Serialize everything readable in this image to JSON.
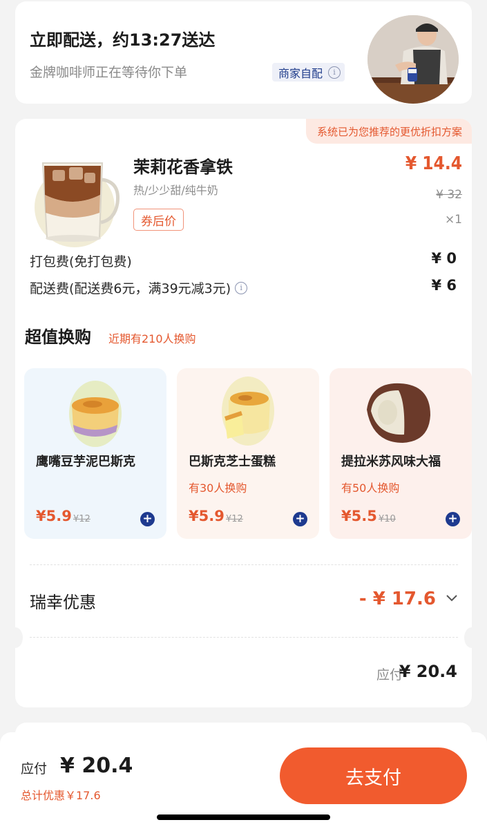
{
  "delivery": {
    "title": "立即配送，约13:27送达",
    "subtitle": "金牌咖啡师正在等待你下单",
    "tag": "商家自配",
    "info_icon": "info-circle-icon"
  },
  "order": {
    "recommend_banner": "系统已为您推荐的更优折扣方案",
    "product": {
      "name": "茉莉花香拿铁",
      "options": "热/少少甜/纯牛奶",
      "coupon_tag": "券后价",
      "price": "¥ 14.4",
      "original_price": "¥ 32",
      "quantity": "×1"
    },
    "packing_fee": {
      "label": "打包费(免打包费)",
      "value": "¥ 0"
    },
    "delivery_fee": {
      "label": "配送费(配送费6元，满39元减3元)",
      "value": "¥ 6"
    }
  },
  "swap": {
    "title": "超值换购",
    "subtitle": "近期有210人换购",
    "items": [
      {
        "name": "鹰嘴豆芋泥巴斯克",
        "meta": "",
        "price": "¥5.9",
        "original": "¥12",
        "bg": "#eff6fc"
      },
      {
        "name": "巴斯克芝士蛋糕",
        "meta": "有30人换购",
        "price": "¥5.9",
        "original": "¥12",
        "bg": "#fdf4ef"
      },
      {
        "name": "提拉米苏风味大福",
        "meta": "有50人换购",
        "price": "¥5.5",
        "original": "¥10",
        "bg": "#fdf0ec"
      }
    ]
  },
  "discount": {
    "label": "瑞幸优惠",
    "value": "- ¥ 17.6"
  },
  "payable": {
    "label": "应付",
    "value": "¥ 20.4"
  },
  "bottom_bar": {
    "label": "应付",
    "value": "¥ 20.4",
    "total_discount": "总计优惠￥17.6",
    "pay_button": "去支付"
  },
  "colors": {
    "accent": "#e4582f",
    "brand_blue": "#1e3a8f",
    "pay_button": "#f15b2e"
  }
}
